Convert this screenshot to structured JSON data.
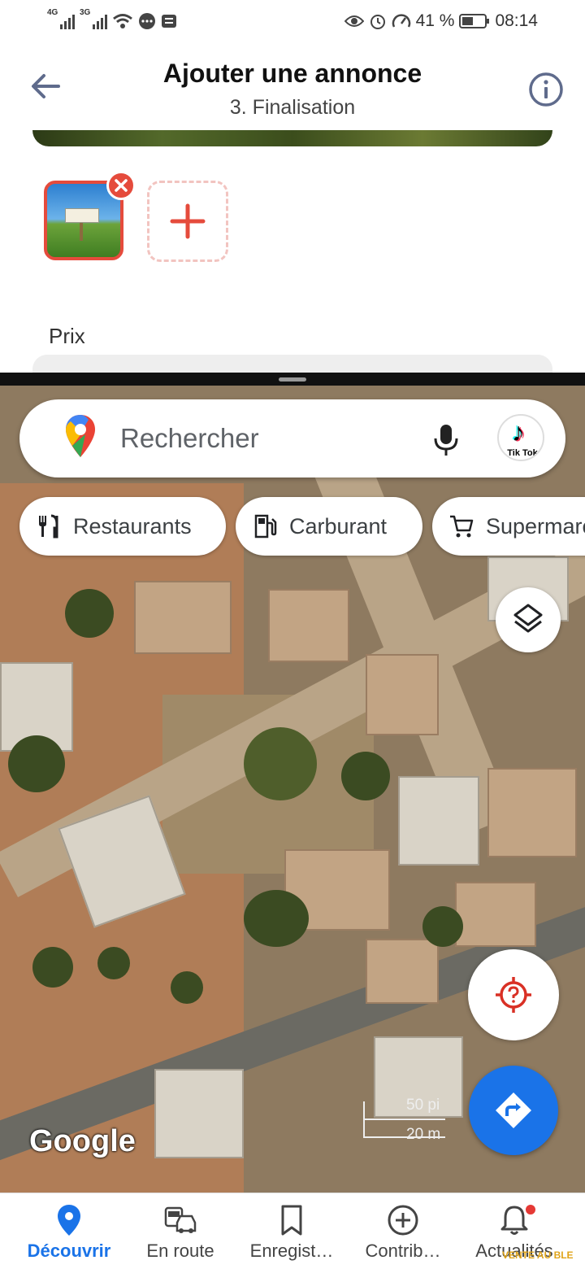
{
  "status_bar": {
    "net1": "4G",
    "net2": "3G",
    "battery_pct": "41 %",
    "time": "08:14"
  },
  "header": {
    "title": "Ajouter une annonce",
    "subtitle": "3. Finalisation"
  },
  "form": {
    "price_label": "Prix"
  },
  "photo_sign_text": "VENTE AU BLE",
  "maps": {
    "search_placeholder": "Rechercher",
    "tiktok_label": "Tik Tok",
    "chips": [
      {
        "label": "Restaurants",
        "icon": "restaurant-icon"
      },
      {
        "label": "Carburant",
        "icon": "fuel-icon"
      },
      {
        "label": "Supermarchés",
        "icon": "cart-icon"
      }
    ],
    "scale": {
      "imperial": "50 pi",
      "metric": "20 m"
    },
    "google_logo": "Google"
  },
  "bottom_nav": [
    {
      "label": "Découvrir",
      "icon": "location-pin-icon",
      "active": true
    },
    {
      "label": "En route",
      "icon": "commute-icon",
      "active": false
    },
    {
      "label": "Enregist…",
      "icon": "bookmark-icon",
      "active": false
    },
    {
      "label": "Contrib…",
      "icon": "add-circle-icon",
      "active": false
    },
    {
      "label": "Actualités",
      "icon": "bell-icon",
      "active": false
    }
  ],
  "watermark": "VENTE AU BLE",
  "colors": {
    "accent_red": "#e54b3c",
    "maps_blue": "#1a73e8"
  }
}
